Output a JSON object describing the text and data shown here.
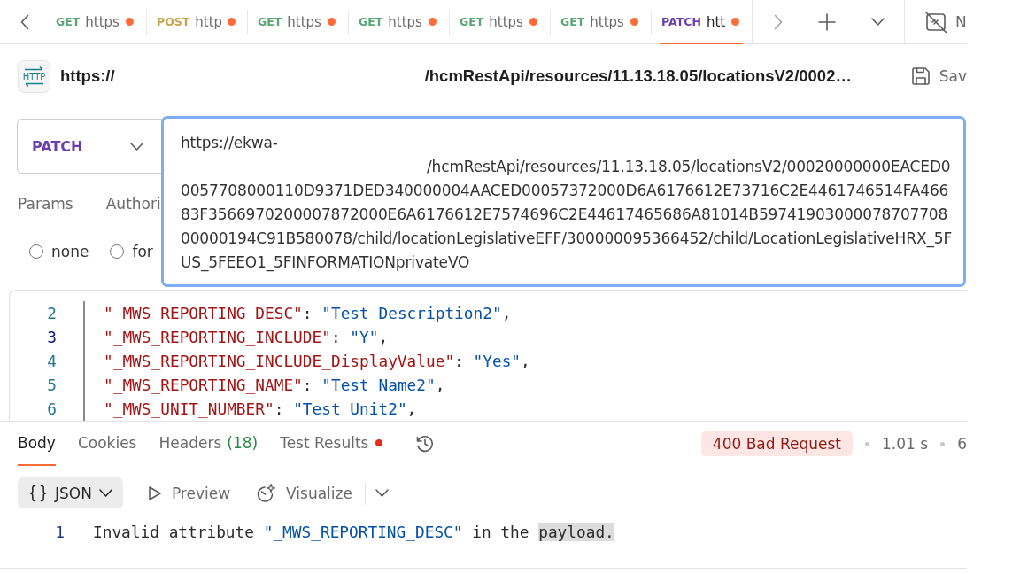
{
  "tabs": [
    {
      "method": "GET",
      "title": "https",
      "color": "#5aa676",
      "unsaved": true,
      "selected": false
    },
    {
      "method": "POST",
      "title": "http",
      "color": "#c8a34b",
      "unsaved": true,
      "selected": false
    },
    {
      "method": "GET",
      "title": "https",
      "color": "#5aa676",
      "unsaved": true,
      "selected": false
    },
    {
      "method": "GET",
      "title": "https",
      "color": "#5aa676",
      "unsaved": true,
      "selected": false
    },
    {
      "method": "GET",
      "title": "https",
      "color": "#5aa676",
      "unsaved": true,
      "selected": false
    },
    {
      "method": "GET",
      "title": "https",
      "color": "#5aa676",
      "unsaved": true,
      "selected": false
    },
    {
      "method": "PATCH",
      "title": "htt",
      "color": "#6c3fae",
      "unsaved": true,
      "selected": true
    }
  ],
  "environment": {
    "label": "N"
  },
  "request_header": {
    "icon_label": "HTTP",
    "name_start": "https://",
    "name_path": "/hcmRestApi/resources/11.13.18.05/locationsV2/0002…",
    "save_label": "Sav"
  },
  "request": {
    "method": "PATCH",
    "url_start": "https://ekwa-",
    "url_rest": "/hcmRestApi/resources/11.13.18.05/locationsV2/00020000000EACED00057708000110D9371DED340000004AACED00057372000D6A6176612E73716C2E4461746514FA46683F3566970200007872000E6A6176612E7574696C2E44617465686A81014B5974190300007870770800000194C91B580078/child/locationLegislativeEFF/300000095366452/child/LocationLegislativeHRX_5FUS_5FEEO1_5FINFORMATIONprivateVO"
  },
  "request_tabs": [
    {
      "label": "Params",
      "selected": false
    },
    {
      "label": "Authori",
      "selected": false
    }
  ],
  "body_modes": [
    {
      "label": "none",
      "selected": false
    },
    {
      "label": "for",
      "selected": false
    }
  ],
  "body_editor": {
    "lines": [
      {
        "number": "2",
        "current": false,
        "tokens": [
          {
            "kind": "key",
            "text": "\"_MWS_REPORTING_DESC\""
          },
          {
            "kind": "punct",
            "text": ": "
          },
          {
            "kind": "string",
            "text": "\"Test Description2\""
          },
          {
            "kind": "punct",
            "text": ","
          }
        ]
      },
      {
        "number": "3",
        "current": true,
        "tokens": [
          {
            "kind": "key",
            "text": "\"_MWS_REPORTING_INCLUDE\""
          },
          {
            "kind": "punct",
            "text": ": "
          },
          {
            "kind": "string",
            "text": "\"Y\""
          },
          {
            "kind": "punct",
            "text": ","
          }
        ]
      },
      {
        "number": "4",
        "current": false,
        "tokens": [
          {
            "kind": "key",
            "text": "\"_MWS_REPORTING_INCLUDE_DisplayValue\""
          },
          {
            "kind": "punct",
            "text": ": "
          },
          {
            "kind": "string",
            "text": "\"Yes\""
          },
          {
            "kind": "punct",
            "text": ","
          }
        ]
      },
      {
        "number": "5",
        "current": false,
        "tokens": [
          {
            "kind": "key",
            "text": "\"_MWS_REPORTING_NAME\""
          },
          {
            "kind": "punct",
            "text": ": "
          },
          {
            "kind": "string",
            "text": "\"Test Name2\""
          },
          {
            "kind": "punct",
            "text": ","
          }
        ]
      },
      {
        "number": "6",
        "current": false,
        "tokens": [
          {
            "kind": "key",
            "text": "\"_MWS_UNIT_NUMBER\""
          },
          {
            "kind": "punct",
            "text": ": "
          },
          {
            "kind": "string",
            "text": "\"Test Unit2\""
          },
          {
            "kind": "punct",
            "text": ","
          }
        ]
      }
    ]
  },
  "response": {
    "tabs": [
      {
        "label": "Body",
        "selected": true
      },
      {
        "label": "Cookies",
        "selected": false
      },
      {
        "label": "Headers",
        "count": "(18)",
        "selected": false
      },
      {
        "label": "Test Results",
        "alert": true,
        "selected": false
      }
    ],
    "status": "400 Bad Request",
    "meta": [
      "1.01 s",
      "6"
    ],
    "format": "JSON",
    "views": [
      {
        "kind": "preview",
        "label": "Preview"
      },
      {
        "kind": "visualize",
        "label": "Visualize"
      }
    ],
    "lines": [
      {
        "number": "1",
        "tokens": [
          {
            "kind": "plain",
            "text": "Invalid attribute "
          },
          {
            "kind": "string",
            "text": "\"_MWS_REPORTING_DESC\""
          },
          {
            "kind": "plain",
            "text": " in the "
          },
          {
            "kind": "selection",
            "text": "payload."
          }
        ]
      }
    ]
  }
}
